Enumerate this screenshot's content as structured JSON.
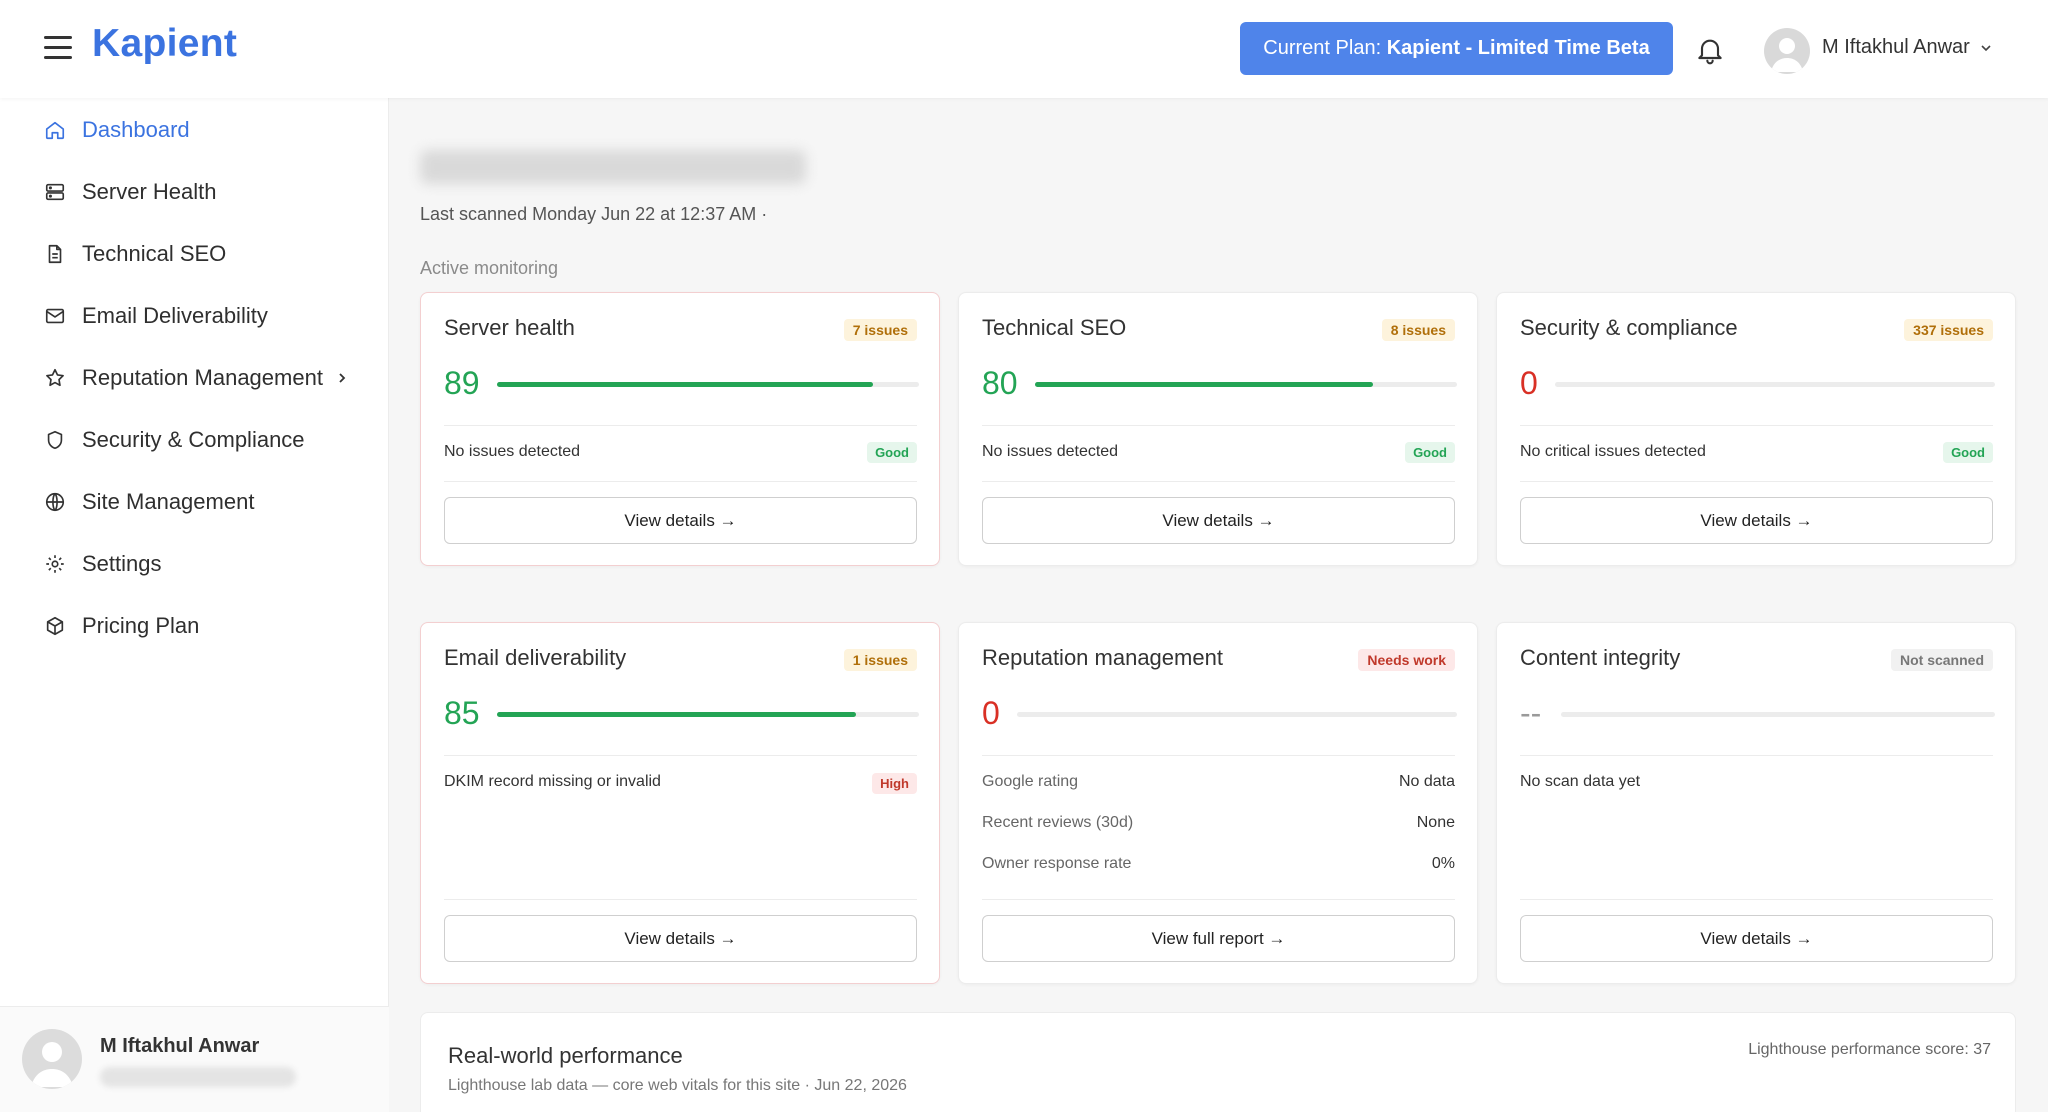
{
  "header": {
    "logo": "Kapient",
    "plan_prefix": "Current Plan: ",
    "plan_name": "Kapient - Limited Time Beta",
    "user_name": "M Iftakhul Anwar"
  },
  "sidebar": {
    "items": [
      {
        "label": "Dashboard",
        "icon": "home-icon",
        "active": true
      },
      {
        "label": "Server Health",
        "icon": "server-icon"
      },
      {
        "label": "Technical SEO",
        "icon": "document-icon"
      },
      {
        "label": "Email Deliverability",
        "icon": "mail-icon"
      },
      {
        "label": "Reputation Management",
        "icon": "star-icon",
        "has_submenu": true
      },
      {
        "label": "Security & Compliance",
        "icon": "shield-icon"
      },
      {
        "label": "Site Management",
        "icon": "globe-icon"
      },
      {
        "label": "Settings",
        "icon": "gear-icon"
      },
      {
        "label": "Pricing Plan",
        "icon": "box-icon"
      }
    ],
    "footer_name": "M Iftakhul Anwar"
  },
  "main": {
    "last_scanned": "Last scanned Monday Jun 22 at 12:37 AM ·",
    "section_label": "Active monitoring",
    "cards": {
      "server": {
        "title": "Server health",
        "badge": "7 issues",
        "score": "89",
        "progress": 0.89,
        "status_text": "No issues detected",
        "status_pill": "Good",
        "button": "View details →"
      },
      "seo": {
        "title": "Technical SEO",
        "badge": "8 issues",
        "score": "80",
        "progress": 0.8,
        "status_text": "No issues detected",
        "status_pill": "Good",
        "button": "View details →"
      },
      "security": {
        "title": "Security & compliance",
        "badge": "337 issues",
        "score": "0",
        "progress": 0,
        "status_text": "No critical issues detected",
        "status_pill": "Good",
        "button": "View details →"
      },
      "email": {
        "title": "Email deliverability",
        "badge": "1 issues",
        "score": "85",
        "progress": 0.85,
        "status_text": "DKIM record missing or invalid",
        "status_pill": "High",
        "button": "View details →"
      },
      "reputation": {
        "title": "Reputation management",
        "badge": "Needs work",
        "score": "0",
        "progress": 0,
        "rows": [
          {
            "label": "Google rating",
            "value": "No data"
          },
          {
            "label": "Recent reviews (30d)",
            "value": "None"
          },
          {
            "label": "Owner response rate",
            "value": "0%"
          }
        ],
        "button": "View full report →"
      },
      "content": {
        "title": "Content integrity",
        "badge": "Not scanned",
        "score": "--",
        "progress": 0,
        "status_text": "No scan data yet",
        "button": "View details →"
      }
    },
    "performance": {
      "title": "Real-world performance",
      "subtitle": "Lighthouse lab data — core web vitals for this site · Jun 22, 2026",
      "score_text": "Lighthouse performance score: 37"
    }
  }
}
